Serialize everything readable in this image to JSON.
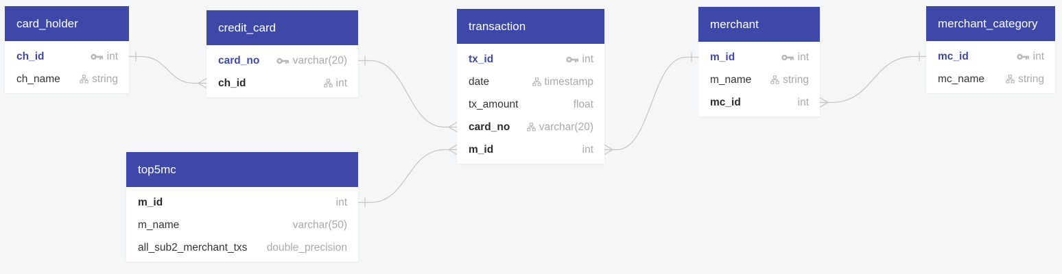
{
  "theme": {
    "header_color": "#3e48a8",
    "pk_color": "#3e48a8",
    "link_color": "#c4c4c4",
    "background": "#f5f6f7"
  },
  "tables": [
    {
      "id": "card_holder",
      "name": "card_holder",
      "columns": [
        {
          "name": "ch_id",
          "type": "int",
          "pk": true,
          "icon": "key-icon"
        },
        {
          "name": "ch_name",
          "type": "string",
          "icon": "index-icon"
        }
      ]
    },
    {
      "id": "credit_card",
      "name": "credit_card",
      "columns": [
        {
          "name": "card_no",
          "type": "varchar(20)",
          "pk": true,
          "icon": "key-icon"
        },
        {
          "name": "ch_id",
          "type": "int",
          "fk": true,
          "icon": "index-icon"
        }
      ]
    },
    {
      "id": "transaction",
      "name": "transaction",
      "columns": [
        {
          "name": "tx_id",
          "type": "int",
          "pk": true,
          "icon": "key-icon"
        },
        {
          "name": "date",
          "type": "timestamp",
          "icon": "index-icon"
        },
        {
          "name": "tx_amount",
          "type": "float"
        },
        {
          "name": "card_no",
          "type": "varchar(20)",
          "fk": true,
          "icon": "index-icon"
        },
        {
          "name": "m_id",
          "type": "int",
          "fk": true
        }
      ]
    },
    {
      "id": "merchant",
      "name": "merchant",
      "columns": [
        {
          "name": "m_id",
          "type": "int",
          "pk": true,
          "icon": "key-icon"
        },
        {
          "name": "m_name",
          "type": "string",
          "icon": "index-icon"
        },
        {
          "name": "mc_id",
          "type": "int",
          "fk": true
        }
      ]
    },
    {
      "id": "merchant_category",
      "name": "merchant_category",
      "columns": [
        {
          "name": "mc_id",
          "type": "int",
          "pk": true,
          "icon": "key-icon"
        },
        {
          "name": "mc_name",
          "type": "string",
          "icon": "index-icon"
        }
      ]
    },
    {
      "id": "top5mc",
      "name": "top5mc",
      "columns": [
        {
          "name": "m_id",
          "type": "int",
          "fk": true
        },
        {
          "name": "m_name",
          "type": "varchar(50)"
        },
        {
          "name": "all_sub2_merchant_txs",
          "type": "double_precision"
        }
      ]
    }
  ],
  "relationships": [
    {
      "from": "card_holder.ch_id",
      "to": "credit_card.ch_id",
      "from_end": "one",
      "to_end": "many"
    },
    {
      "from": "credit_card.card_no",
      "to": "transaction.card_no",
      "from_end": "one",
      "to_end": "many"
    },
    {
      "from": "top5mc.m_id",
      "to": "transaction.m_id",
      "from_end": "one",
      "to_end": "many"
    },
    {
      "from": "transaction.m_id",
      "to": "merchant.m_id",
      "from_end": "many",
      "to_end": "one"
    },
    {
      "from": "merchant.mc_id",
      "to": "merchant_category.mc_id",
      "from_end": "many",
      "to_end": "one"
    }
  ]
}
